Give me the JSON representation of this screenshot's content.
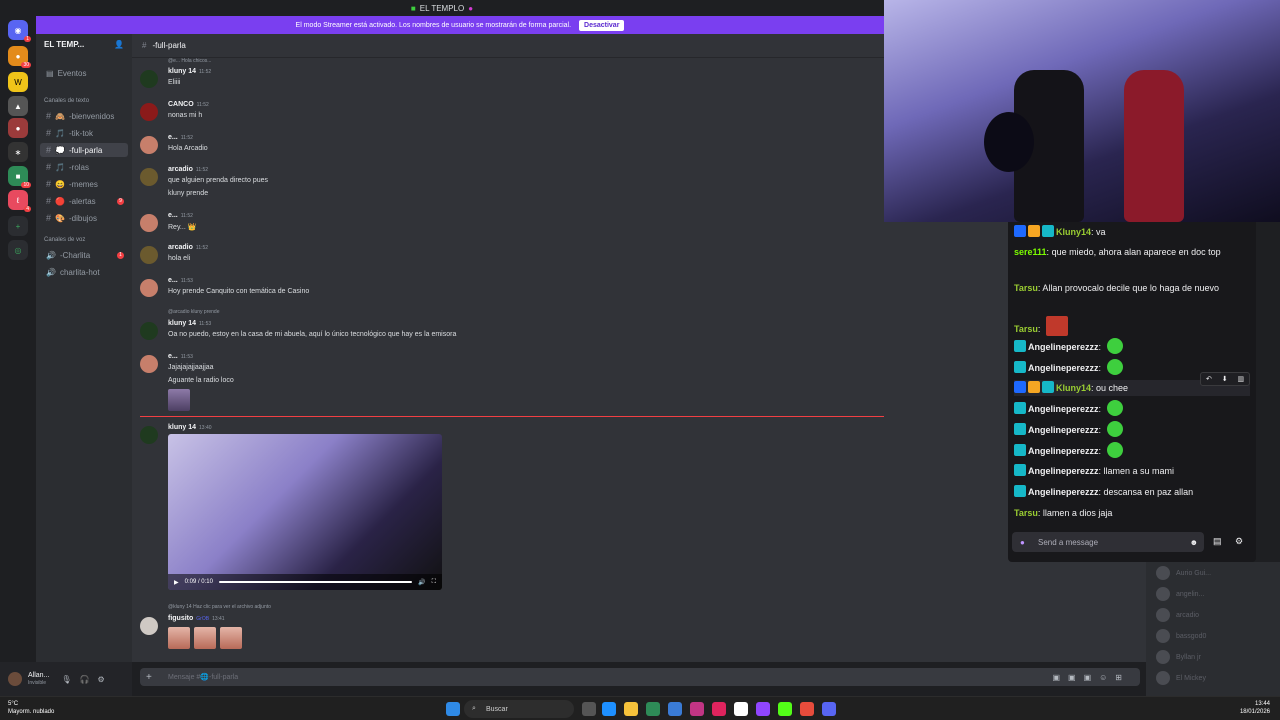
{
  "titlebar": {
    "title": "EL TEMPLO"
  },
  "banner": {
    "text": "El modo Streamer está activado. Los nombres de usuario se mostrarán de forma parcial.",
    "button": "Desactivar"
  },
  "server": {
    "name": "EL TEMP...",
    "events": "Eventos",
    "cat_text": "Canales de texto",
    "cat_voice": "Canales de voz"
  },
  "channels": [
    {
      "label": "-bienvenidos",
      "emoji": "🙈"
    },
    {
      "label": "-tik-tok",
      "emoji": "🎵"
    },
    {
      "label": "-full-parla",
      "emoji": "💭"
    },
    {
      "label": "-rolas",
      "emoji": "🎵"
    },
    {
      "label": "-memes",
      "emoji": "😄"
    },
    {
      "label": "-alertas",
      "emoji": "🔴",
      "badge": "9"
    },
    {
      "label": "-dibujos",
      "emoji": "🎨"
    }
  ],
  "voice": [
    {
      "label": "-Charlita",
      "badge": "1"
    },
    {
      "label": "charlita-hot"
    }
  ],
  "user": {
    "name": "Allan...",
    "status": "Invisible"
  },
  "chat": {
    "channel": "-full-parla",
    "reply_top": "@e... Hola chicos...",
    "messages": [
      {
        "author": "kluny 14",
        "time": "11:52",
        "lines": [
          "Eliiii"
        ]
      },
      {
        "author": "CANCO",
        "time": "11:52",
        "lines": [
          "nonas mi h"
        ]
      },
      {
        "author": "e...",
        "time": "11:52",
        "lines": [
          "Hola Arcadio"
        ]
      },
      {
        "author": "arcadio",
        "time": "11:52",
        "lines": [
          "que alguien prenda directo pues",
          "kluny prende"
        ]
      },
      {
        "author": "e...",
        "time": "11:52",
        "lines": [
          "Rey... 👑"
        ]
      },
      {
        "author": "arcadio",
        "time": "11:52",
        "lines": [
          "hola eli"
        ]
      },
      {
        "author": "e...",
        "time": "11:53",
        "lines": [
          "Hoy prende Canquito con temática de Casino"
        ]
      },
      {
        "author": "kluny 14",
        "time": "11:53",
        "lines": [
          "Oa no puedo, estoy en la casa de mi abuela, aquí lo único tecnológico que hay es la emisora"
        ]
      },
      {
        "author": "e...",
        "time": "11:53",
        "lines": [
          "Jajajajajjaajjaa",
          "Aguante la radio loco"
        ]
      },
      {
        "author": "kluny 14",
        "time": "13:40",
        "lines": []
      },
      {
        "author": "figusito",
        "time": "13:41",
        "tag": "GrOB",
        "lines": []
      }
    ],
    "reply_arcadio": "@arcadio kluny prende",
    "reply_kluny": "@kluny 14 Haz clic para ver el archivo adjunto",
    "video_time": "0:09 / 0:10",
    "composer_placeholder": "Mensaje #🌐-full-parla"
  },
  "twitch": {
    "messages": [
      {
        "user": "Kluny14",
        "color": "#9acd32",
        "text": "va"
      },
      {
        "user": "sere111",
        "color": "#7cfc00",
        "text": "que miedo, ahora alan aparece en doc top"
      },
      {
        "user": "Tarsu",
        "color": "#9acd32",
        "text": "Allan provocalo decile que lo haga de nuevo"
      },
      {
        "user": "Tarsu",
        "color": "#9acd32",
        "text": ""
      },
      {
        "user": "Angelineperezzz",
        "color": "#efeff1",
        "text": ""
      },
      {
        "user": "Angelineperezzz",
        "color": "#efeff1",
        "text": ""
      },
      {
        "user": "Kluny14",
        "color": "#9acd32",
        "text": "ou chee"
      },
      {
        "user": "Angelineperezzz",
        "color": "#efeff1",
        "text": ""
      },
      {
        "user": "Angelineperezzz",
        "color": "#efeff1",
        "text": ""
      },
      {
        "user": "Angelineperezzz",
        "color": "#efeff1",
        "text": ""
      },
      {
        "user": "Angelineperezzz",
        "color": "#efeff1",
        "text": "llamen a su mami"
      },
      {
        "user": "Angelineperezzz",
        "color": "#efeff1",
        "text": "descansa en paz allan"
      },
      {
        "user": "Tarsu",
        "color": "#9acd32",
        "text": "llamen a dios jaja"
      }
    ],
    "input_placeholder": "Send a message"
  },
  "members": [
    "Aurio Gui...",
    "angelin...",
    "arcadio",
    "bassgod0",
    "Byllan jr",
    "El Mickey"
  ],
  "taskbar": {
    "temp": "5°C",
    "weather": "Mayorm. nublado",
    "search": "Buscar",
    "time": "13:44",
    "date": "18/01/2026"
  },
  "colors": {
    "blurple": "#5865f2",
    "streamer": "#7a3ff0",
    "twitch_bg": "#18181b",
    "unread": "#f23f43"
  }
}
